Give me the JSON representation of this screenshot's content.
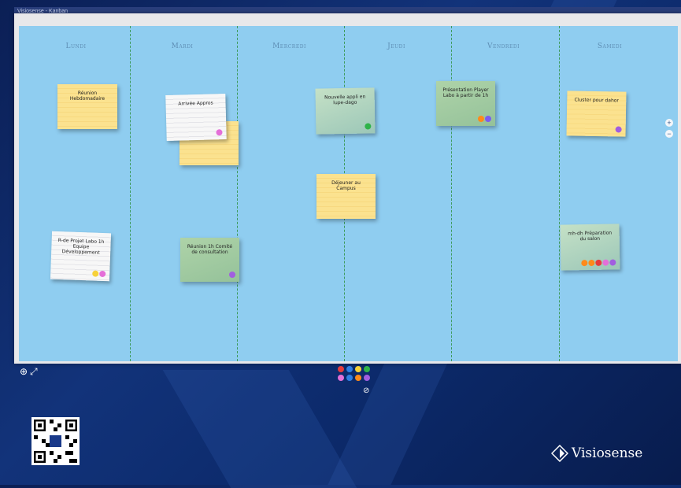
{
  "window": {
    "title": "Visiosense - Kanban"
  },
  "columns": [
    "Lundi",
    "Mardi",
    "Mercredi",
    "Jeudi",
    "Vendredi",
    "Samedi"
  ],
  "notes": [
    {
      "text": "Réunion Hebdomadaire",
      "color": "yellow",
      "dots": []
    },
    {
      "text": "R-de Projet Labo 1h Equipe Développement",
      "color": "white",
      "dots": [
        "#f7d13a",
        "#e46fd8"
      ]
    },
    {
      "text": "Arrivée Appros",
      "color": "white",
      "dots": [
        "#e46fd8"
      ]
    },
    {
      "text": "Réunion 1h Comité de consultation",
      "color": "green",
      "dots": [
        "#a15ee0"
      ]
    },
    {
      "text": "Nouvelle appli en lupe-dago",
      "color": "teal",
      "dots": [
        "#2fb34a"
      ]
    },
    {
      "text": "Déjeuner au Campus",
      "color": "yellow",
      "dots": []
    },
    {
      "text": "Présentation Player Labo à partir de 1h",
      "color": "green",
      "dots": [
        "#ff8a1a",
        "#7b5cf0"
      ]
    },
    {
      "text": "Cluster pour dahor",
      "color": "yellow",
      "dots": [
        "#a15ee0"
      ]
    },
    {
      "text": "mh-dh Préparation du salon",
      "color": "teal",
      "dots": [
        "#ff8a1a",
        "#ff8a1a",
        "#e63b3b",
        "#e46fd8",
        "#a15ee0"
      ]
    }
  ],
  "zoom": {
    "in_icon": "plus-icon",
    "out_icon": "minus-icon"
  },
  "toolbar": {
    "add_icon": "plus-circle-icon",
    "fullscreen_icon": "expand-icon"
  },
  "palette": [
    "#e63b3b",
    "#2f7de1",
    "#f7d13a",
    "#2fb34a",
    "#e46fd8",
    "#2f7de1",
    "#ff8a1a",
    "#a15ee0"
  ],
  "palette_clear_icon": "no-symbol-icon",
  "brand": {
    "name": "Visiosense"
  },
  "colors": {
    "board": "#8fcdf0",
    "divider": "#3e9b5c",
    "background": "#0c2a6b"
  }
}
